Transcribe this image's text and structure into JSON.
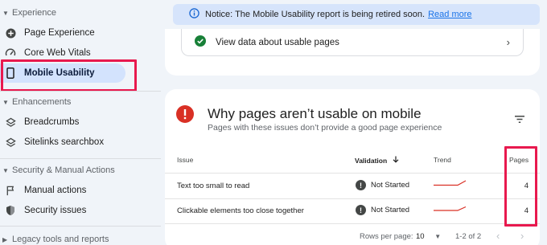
{
  "sidebar": {
    "sections": [
      {
        "title": "Experience",
        "items": [
          {
            "label": "Page Experience",
            "icon": "plus-circle-icon"
          },
          {
            "label": "Core Web Vitals",
            "icon": "gauge-icon"
          },
          {
            "label": "Mobile Usability",
            "icon": "phone-icon",
            "active": true
          }
        ]
      },
      {
        "title": "Enhancements",
        "items": [
          {
            "label": "Breadcrumbs",
            "icon": "layers-icon"
          },
          {
            "label": "Sitelinks searchbox",
            "icon": "layers-icon"
          }
        ]
      },
      {
        "title": "Security & Manual Actions",
        "items": [
          {
            "label": "Manual actions",
            "icon": "flag-icon"
          },
          {
            "label": "Security issues",
            "icon": "shield-icon"
          }
        ]
      },
      {
        "title": "Legacy tools and reports",
        "items": []
      }
    ]
  },
  "notice": {
    "text": "Notice: The Mobile Usability report is being retired soon.",
    "link": "Read more"
  },
  "usable_link": {
    "label": "View data about usable pages"
  },
  "issues_card": {
    "title": "Why pages aren’t usable on mobile",
    "subtitle": "Pages with these issues don’t provide a good page experience",
    "headers": {
      "issue": "Issue",
      "validation": "Validation",
      "trend": "Trend",
      "pages": "Pages"
    },
    "rows": [
      {
        "issue": "Text too small to read",
        "validation": "Not Started",
        "pages": "4"
      },
      {
        "issue": "Clickable elements too close together",
        "validation": "Not Started",
        "pages": "4"
      }
    ],
    "pager": {
      "rows_label": "Rows per page:",
      "rows_value": "10",
      "range": "1-2 of 2"
    }
  },
  "colors": {
    "accent_blue": "#1a73e8",
    "error_red": "#d93025",
    "highlight": "#e8194e",
    "trend_red": "#d93025"
  }
}
